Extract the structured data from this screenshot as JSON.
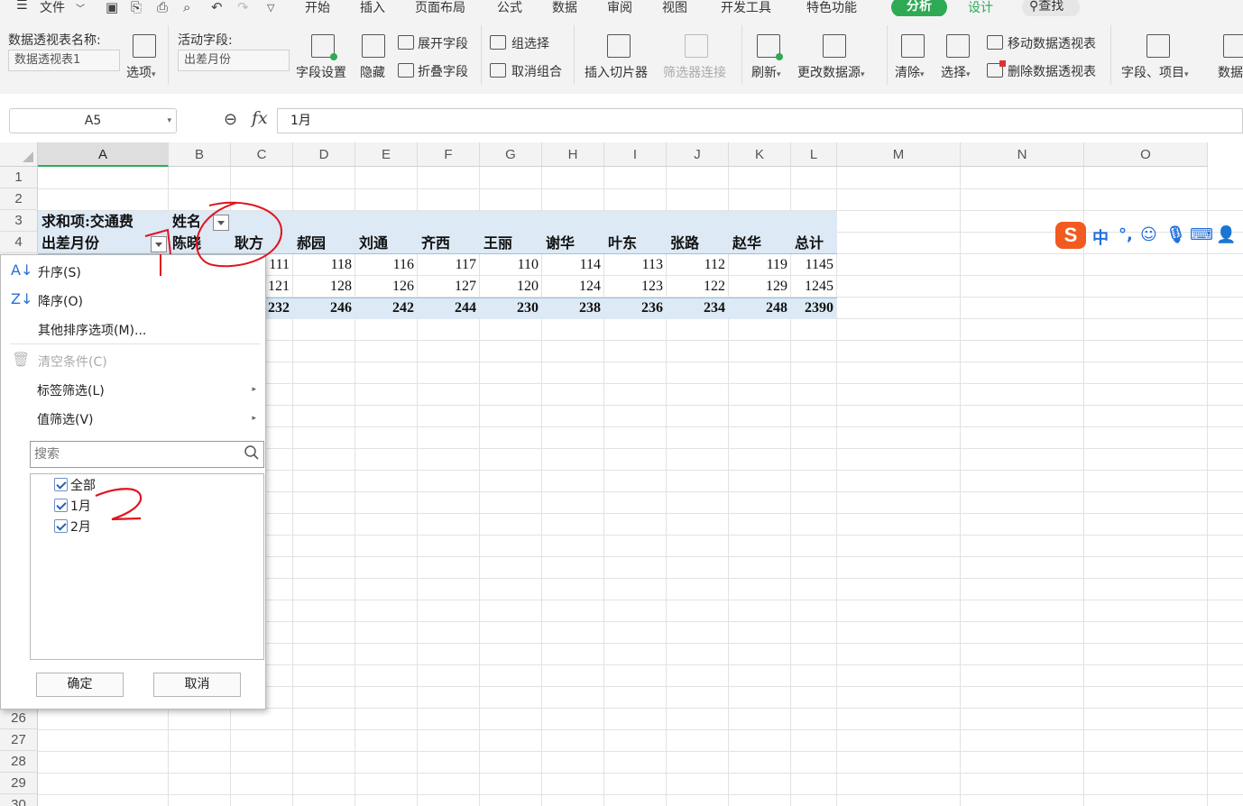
{
  "menu": {
    "file_label": "文件",
    "tabs": [
      "开始",
      "插入",
      "页面布局",
      "公式",
      "数据",
      "审阅",
      "视图",
      "开发工具",
      "特色功能"
    ],
    "active_tab": "分析",
    "design_tab": "设计",
    "search_label": "查找"
  },
  "ribbon": {
    "pivot_name_label": "数据透视表名称:",
    "pivot_name_value": "数据透视表1",
    "options_label": "选项",
    "active_field_label": "活动字段:",
    "active_field_value": "出差月份",
    "field_settings": "字段设置",
    "hide": "隐藏",
    "expand_field": "展开字段",
    "collapse_field": "折叠字段",
    "group_selection": "组选择",
    "ungroup": "取消组合",
    "insert_slicer": "插入切片器",
    "filter_connections": "筛选器连接",
    "refresh": "刷新",
    "change_source": "更改数据源",
    "clear": "清除",
    "select": "选择",
    "move_pivot": "移动数据透视表",
    "delete_pivot": "删除数据透视表",
    "fields_items": "字段、项目",
    "data_cut": "数据"
  },
  "formula_bar": {
    "cell_ref": "A5",
    "fx": "fx",
    "value": "1月"
  },
  "sheet": {
    "columns": [
      "A",
      "B",
      "C",
      "D",
      "E",
      "F",
      "G",
      "H",
      "I",
      "J",
      "K",
      "L",
      "M",
      "N",
      "O"
    ],
    "top_rows": [
      "1",
      "2",
      "3",
      "4"
    ],
    "bottom_rows": [
      "26",
      "27",
      "28",
      "29",
      "30"
    ],
    "sum_label": "求和项:交通费",
    "col_field_label": "姓名",
    "row_field_label": "出差月份",
    "names": [
      "陈晓",
      "耿方",
      "郝园",
      "刘通",
      "齐西",
      "王丽",
      "谢华",
      "叶东",
      "张路",
      "赵华",
      "总计"
    ],
    "row1_values": [
      "111",
      "118",
      "116",
      "117",
      "110",
      "114",
      "113",
      "112",
      "119",
      "1145"
    ],
    "row2_values": [
      "121",
      "128",
      "126",
      "127",
      "120",
      "124",
      "123",
      "122",
      "129",
      "1245"
    ],
    "total_values": [
      "232",
      "246",
      "242",
      "244",
      "230",
      "238",
      "236",
      "234",
      "248",
      "2390"
    ]
  },
  "filter_popup": {
    "sort_asc": "升序(S)",
    "sort_desc": "降序(O)",
    "more_sort": "其他排序选项(M)...",
    "clear_filter": "清空条件(C)",
    "label_filter": "标签筛选(L)",
    "value_filter": "值筛选(V)",
    "search_placeholder": "搜索",
    "items": [
      "全部",
      "1月",
      "2月"
    ],
    "ok": "确定",
    "cancel": "取消"
  },
  "ime": {
    "lang": "中",
    "punct": "°,"
  },
  "colors": {
    "accent": "#2eaa55",
    "pivot_band": "#dde9f5",
    "annotation": "#e0141e"
  }
}
